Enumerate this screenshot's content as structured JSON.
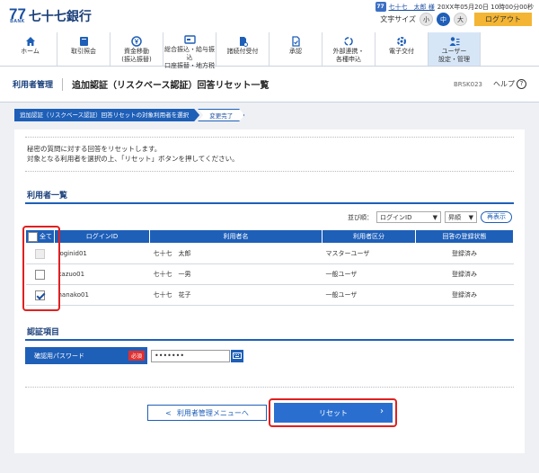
{
  "header": {
    "logo_mark": "77",
    "logo_sub": "BANK",
    "bank_name": "七十七銀行",
    "user_name": "七十七　太郎 様",
    "login_time": "20XX年05月20日 10時00分00秒",
    "font_size_label": "文字サイズ",
    "font_sizes": [
      "小",
      "中",
      "大"
    ],
    "logout": "ログアウト"
  },
  "nav": [
    {
      "label1": "ホーム",
      "label2": "",
      "icon": "home-icon"
    },
    {
      "label1": "取引照会",
      "label2": "",
      "icon": "book-icon"
    },
    {
      "label1": "資金移動",
      "label2": "(振込振替)",
      "icon": "yen-transfer-icon"
    },
    {
      "label1": "総合振込・給与振込",
      "label2": "口座振替・地方税",
      "icon": "card-icon"
    },
    {
      "label1": "諸続付受付",
      "label2": "",
      "icon": "document-icon"
    },
    {
      "label1": "承認",
      "label2": "",
      "icon": "approval-icon"
    },
    {
      "label1": "外部連携・",
      "label2": "各種申込",
      "icon": "link-icon"
    },
    {
      "label1": "電子交付",
      "label2": "",
      "icon": "gear-icon"
    },
    {
      "label1": "ユーザー",
      "label2": "設定・管理",
      "icon": "user-settings-icon"
    }
  ],
  "title_bar": {
    "section": "利用者管理",
    "title": "追加認証（リスクベース認証）回答リセット一覧",
    "code": "BRSK023",
    "help": "ヘルプ"
  },
  "steps": [
    "追加認証（リスクベース認証）回答リセットの対象利用者を選択",
    "変更完了"
  ],
  "description": [
    "秘密の質問に対する回答をリセットします。",
    "対象となる利用者を選択の上、「リセット」ボタンを押してください。"
  ],
  "user_list": {
    "title": "利用者一覧",
    "sort_label": "並び順：",
    "sort_key": "ログインID",
    "sort_order": "昇順",
    "redisplay": "再表示",
    "columns": [
      "全て",
      "ログインID",
      "利用者名",
      "利用者区分",
      "回答の登録状態"
    ],
    "rows": [
      {
        "id": "loginid01",
        "name": "七十七　太郎",
        "type": "マスターユーザ",
        "status": "登録済み",
        "checked": false,
        "disabled": true
      },
      {
        "id": "kazuo01",
        "name": "七十七　一男",
        "type": "一般ユーザ",
        "status": "登録済み",
        "checked": false,
        "disabled": false
      },
      {
        "id": "hanako01",
        "name": "七十七　花子",
        "type": "一般ユーザ",
        "status": "登録済み",
        "checked": true,
        "disabled": false
      }
    ]
  },
  "auth": {
    "title": "認証項目",
    "pw_label": "確認用パスワード",
    "required": "必須",
    "pw_value": "•••••••"
  },
  "buttons": {
    "back": "利用者管理メニューへ",
    "reset": "リセット"
  }
}
